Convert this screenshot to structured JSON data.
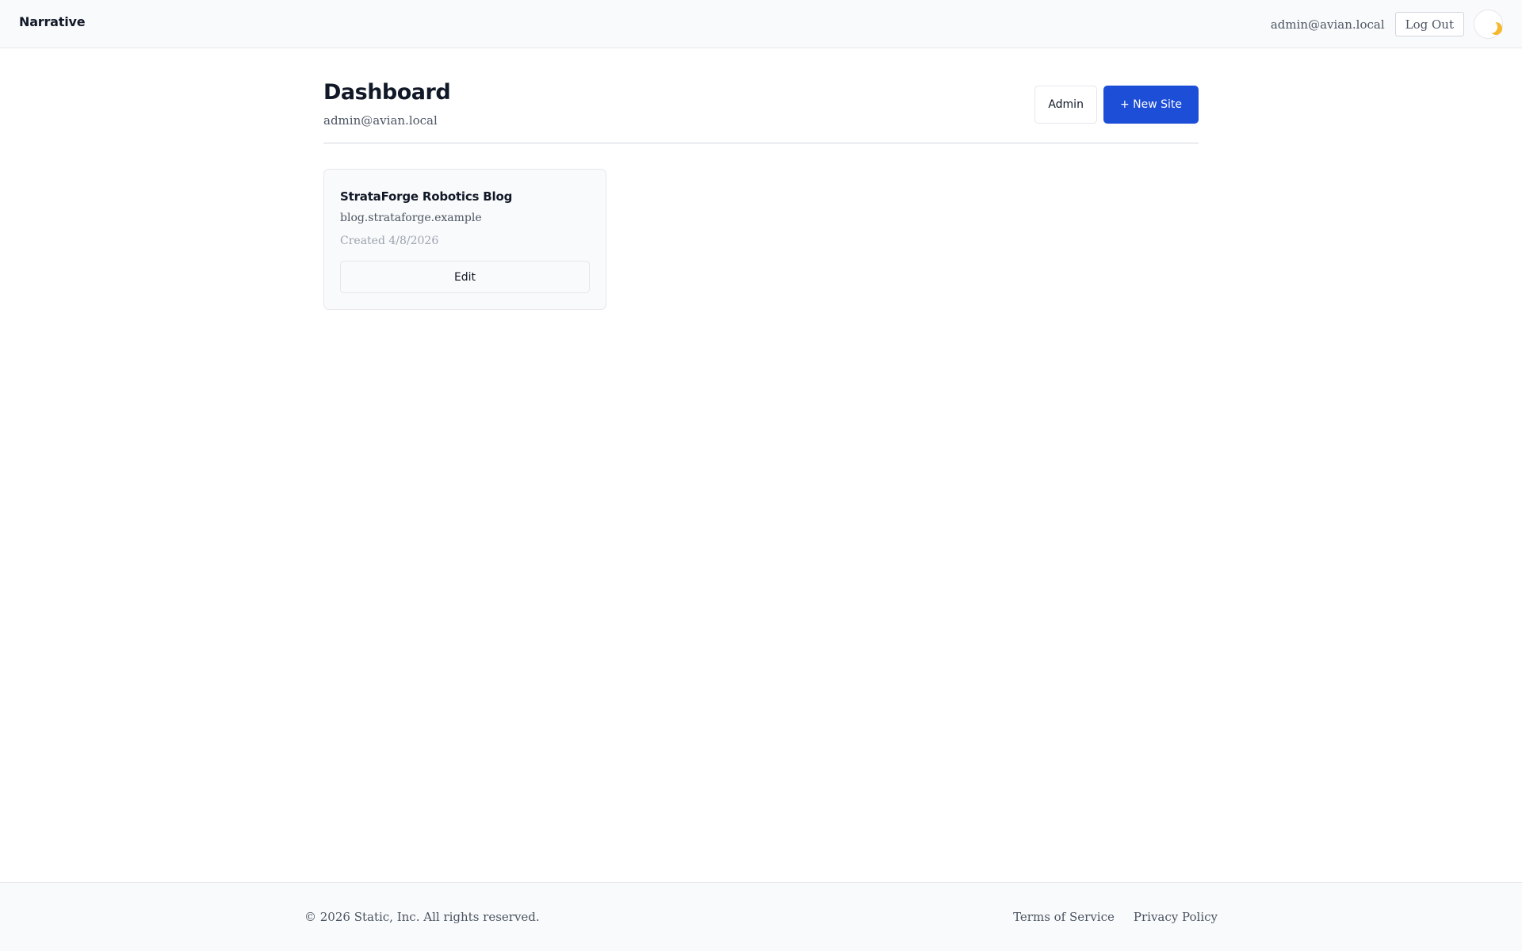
{
  "app": {
    "brand": "Narrative"
  },
  "nav": {
    "user_email": "admin@avian.local",
    "logout_label": "Log Out",
    "theme_icon": "moon-icon",
    "theme_icon_color": "#f5b82e"
  },
  "header": {
    "title": "Dashboard",
    "subtitle": "admin@avian.local",
    "admin_label": "Admin",
    "new_site_label": "+ New Site",
    "accent_color": "#1d4ed8"
  },
  "sites": [
    {
      "name": "StrataForge Robotics Blog",
      "domain": "blog.strataforge.example",
      "created": "Created 4/8/2026",
      "edit_label": "Edit"
    }
  ],
  "footer": {
    "copyright": "© 2026 Static, Inc. All rights reserved.",
    "links": [
      {
        "label": "Terms of Service"
      },
      {
        "label": "Privacy Policy"
      }
    ]
  }
}
